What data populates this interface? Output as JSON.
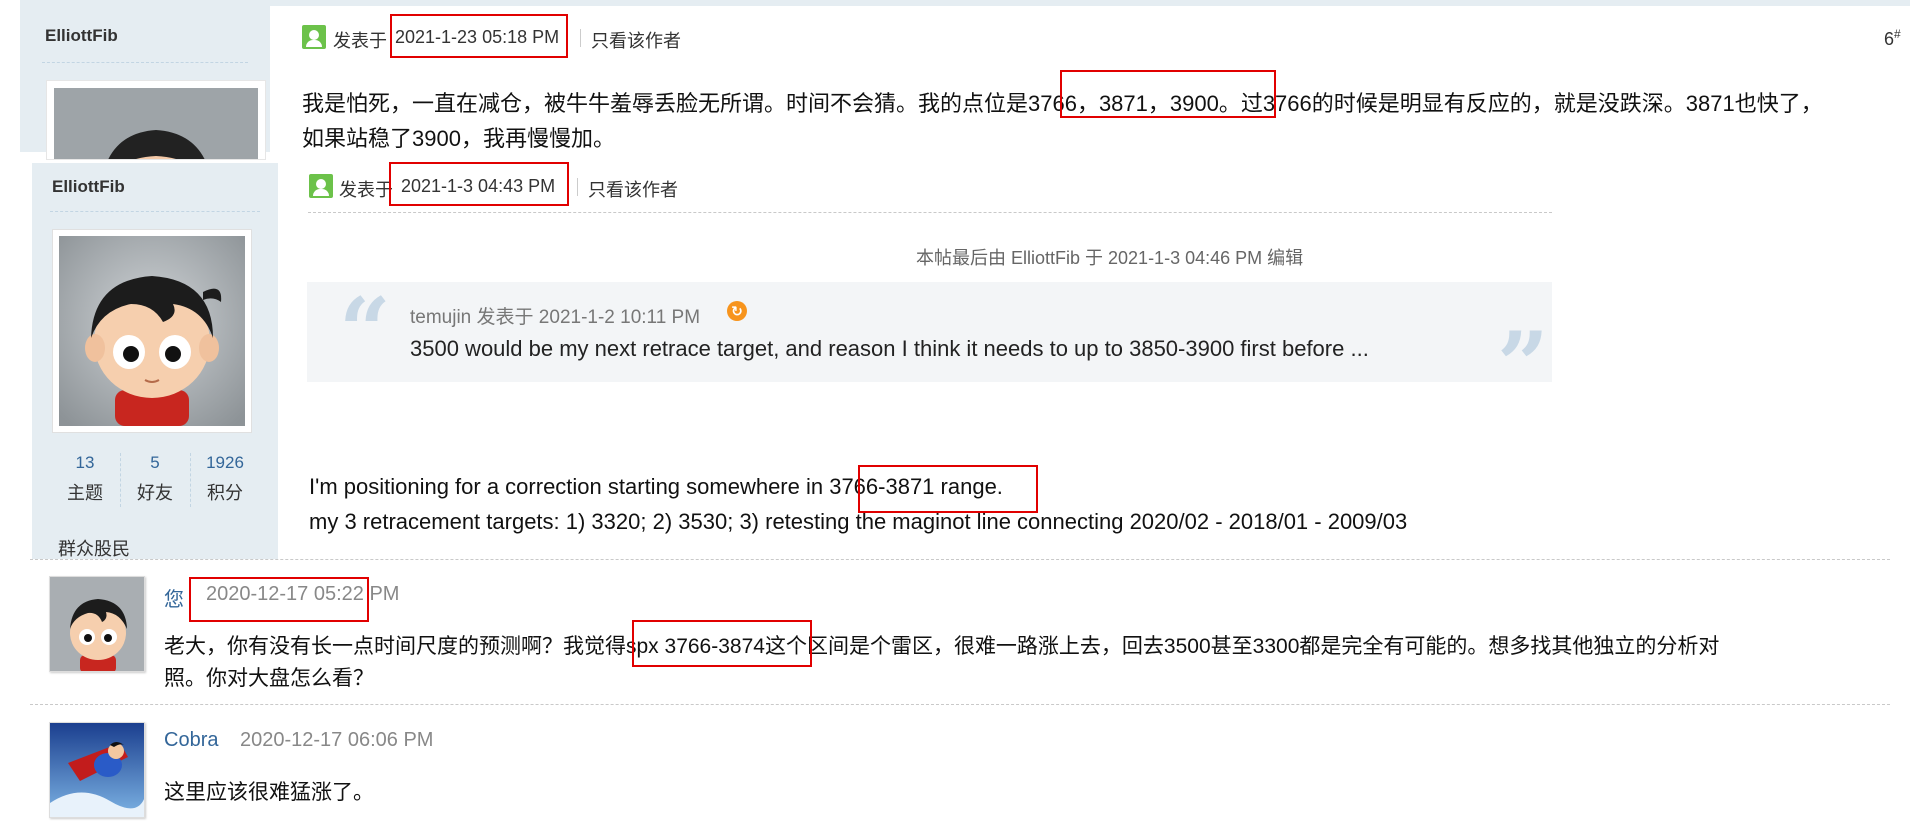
{
  "post_top": {
    "author": "ElliottFib",
    "posted_label": "发表于",
    "posted_time": "2021-1-23 05:18 PM",
    "only_author_link": "只看该作者",
    "floor": "6",
    "floor_suffix": "#",
    "body_line1": "我是怕死，一直在减仓，被牛牛羞辱丢脸无所谓。时间不会猜。我的点位是3766，3871，3900。过3766的时候是明显有反应的，就是没跌深。3871也快了，",
    "body_line2": "如果站稳了3900，我再慢慢加。"
  },
  "post_main": {
    "author": "ElliottFib",
    "posted_label": "发表于",
    "posted_time": "2021-1-3 04:43 PM",
    "only_author_link": "只看该作者",
    "stats": [
      {
        "value": "13",
        "label": "主题"
      },
      {
        "value": "5",
        "label": "好友"
      },
      {
        "value": "1926",
        "label": "积分"
      }
    ],
    "rank": "群众股民",
    "edit_note": "本帖最后由 ElliottFib 于 2021-1-3 04:46 PM 编辑",
    "quote": {
      "author_line": "temujin 发表于 2021-1-2 10:11 PM",
      "text": "3500 would be my next retrace target, and reason I think it needs to up to 3850-3900 first before  ..."
    },
    "body_line1": "I'm positioning for a correction starting somewhere in 3766-3871 range.",
    "body_line2": "my 3 retracement targets: 1) 3320; 2) 3530; 3) retesting the maginot line connecting 2020/02 - 2018/01 - 2009/03"
  },
  "comments": [
    {
      "name": "您",
      "time": "2020-12-17 05:22 PM",
      "line1": "老大，你有没有长一点时间尺度的预测啊？我觉得spx 3766-3874这个区间是个雷区，很难一路涨上去，回去3500甚至3300都是完全有可能的。想多找其他独立的分析对",
      "line2": "照。你对大盘怎么看？"
    },
    {
      "name": "Cobra",
      "time": "2020-12-17 06:06 PM",
      "line1": "这里应该很难猛涨了。"
    }
  ],
  "colors": {
    "sidebar_bg": "#e5edf2",
    "link_blue": "#336699",
    "highlight_red": "#e10000",
    "quote_bg": "#f3f5f7",
    "icon_green": "#6cc24a"
  },
  "icons": {
    "online_status": "user-online-icon",
    "back_to_source": "back-arrow-icon",
    "quote_open": "quote-open-icon",
    "quote_close": "quote-close-icon"
  }
}
